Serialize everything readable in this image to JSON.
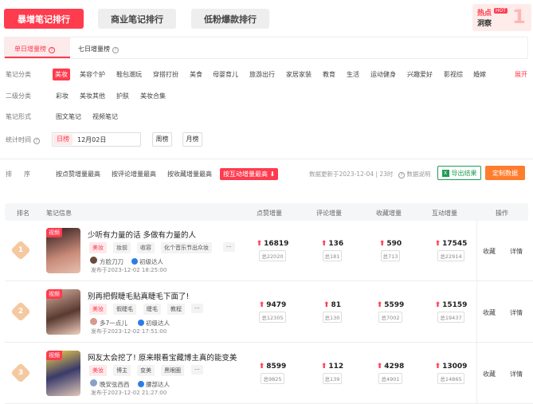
{
  "top_tabs": [
    "暴增笔记排行",
    "商业笔记排行",
    "低粉爆款排行"
  ],
  "banner": {
    "title1": "热点",
    "badge": "HOT",
    "title2": "洞察"
  },
  "sub_tabs": [
    "单日增量榜",
    "七日增量榜"
  ],
  "filters": {
    "category_label": "笔记分类",
    "categories": [
      "美妆",
      "美容个护",
      "鞋包潮玩",
      "穿搭打扮",
      "美食",
      "母婴育儿",
      "旅游出行",
      "家居家装",
      "教育",
      "生活",
      "运动健身",
      "兴趣爱好",
      "影视综",
      "婚嫁"
    ],
    "expand": "展开",
    "sub_label": "二级分类",
    "subcategories": [
      "彩妆",
      "美妆其他",
      "护肤",
      "美妆合集"
    ],
    "form_label": "笔记形式",
    "forms": [
      "图文笔记",
      "视频笔记"
    ],
    "time_label": "统计时间",
    "time_day": "日榜",
    "time_date": "12月02日",
    "time_week": "周榜",
    "time_month": "月榜",
    "sort_label1": "排",
    "sort_label2": "序",
    "sorts": [
      "按点赞增量最高",
      "按评论增量最高",
      "按收藏增量最高",
      "按互动增量最高"
    ],
    "update_text": "数据更新于2023-12-04 | 23时",
    "data_desc": "数据说明",
    "export": "导出结果",
    "custom": "定制数据"
  },
  "table": {
    "headers": [
      "排名",
      "笔记信息",
      "点赞增量",
      "评论增量",
      "收藏增量",
      "互动增量",
      "操作"
    ],
    "rows": [
      {
        "rank": "1",
        "title": "少听有力量的话 多做有力量的人",
        "tags": [
          "美妆",
          "妆前",
          "收容",
          "化个音乐节出众妆",
          "···"
        ],
        "author": "方脸刀刀",
        "level": "初级达人",
        "time": "发布于2023-12-02 18:25:00",
        "likes": "16819",
        "likes_total": "总22020",
        "comments": "136",
        "comments_total": "总181",
        "saves": "590",
        "saves_total": "总713",
        "inter": "17545",
        "inter_total": "总22914",
        "op1": "收藏",
        "op2": "详情",
        "video": "视频"
      },
      {
        "rank": "2",
        "title": "别再把假睫毛贴真睫毛下面了!",
        "tags": [
          "美妆",
          "假睫毛",
          "睫毛",
          "教程",
          "···"
        ],
        "author": "多7一点儿",
        "level": "初级达人",
        "time": "发布于2023-12-02 17:51:00",
        "likes": "9479",
        "likes_total": "总12305",
        "comments": "81",
        "comments_total": "总130",
        "saves": "5599",
        "saves_total": "总7002",
        "inter": "15159",
        "inter_total": "总19437",
        "op1": "收藏",
        "op2": "详情",
        "video": "视频"
      },
      {
        "rank": "3",
        "title": "网友太会挖了! 原来眼看宝藏博主真的能变美",
        "tags": [
          "美妆",
          "博主",
          "变美",
          "黑眼圈",
          "···"
        ],
        "author": "晚安弦西西",
        "level": "腰部达人",
        "time": "发布于2023-12-02 21:27:00",
        "likes": "8599",
        "likes_total": "总9825",
        "comments": "112",
        "comments_total": "总139",
        "saves": "4298",
        "saves_total": "总4901",
        "inter": "13009",
        "inter_total": "总14865",
        "op1": "收藏",
        "op2": "详情",
        "video": "视频"
      }
    ]
  },
  "colors": {
    "accent": "#ff3b4e",
    "export_green": "#1f9d55",
    "custom_orange": "#ff7d2d"
  }
}
